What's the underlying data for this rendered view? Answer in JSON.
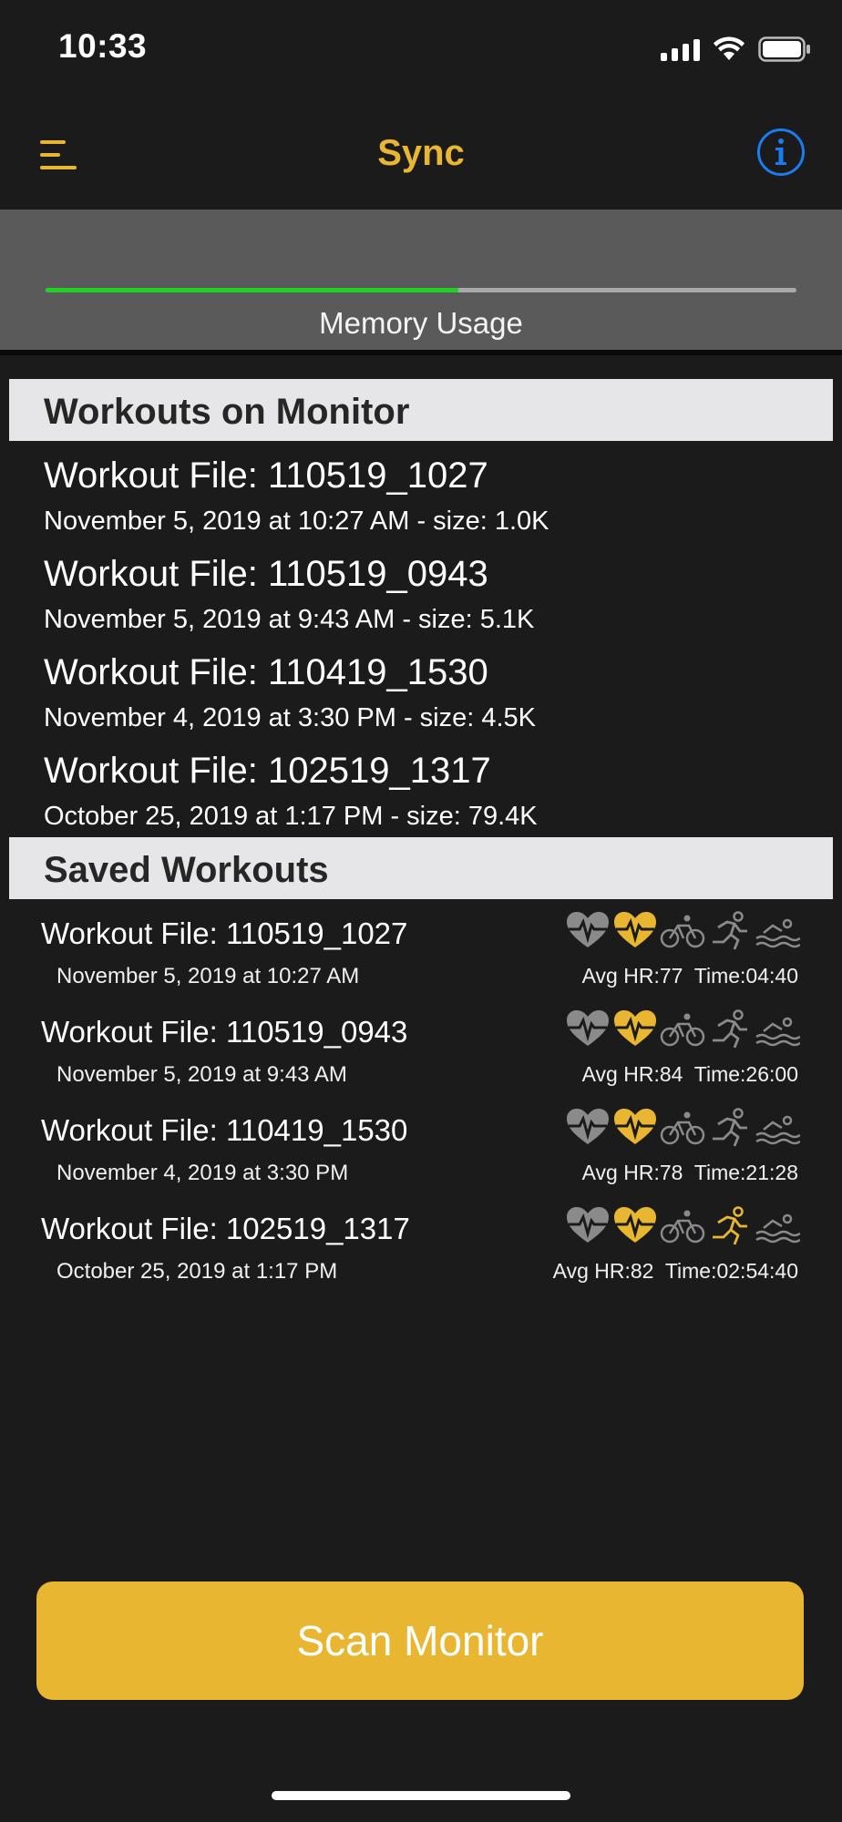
{
  "status_bar": {
    "time": "10:33",
    "icons": [
      "cellular-signal-icon",
      "wifi-icon",
      "battery-icon"
    ]
  },
  "nav": {
    "title": "Sync",
    "menu_icon": "hamburger-menu-icon",
    "info_icon": "info-circle-icon"
  },
  "memory": {
    "label": "Memory Usage",
    "usage_fraction": 0.55
  },
  "monitor_section": {
    "header": "Workouts on Monitor",
    "items": [
      {
        "title": "Workout File: 110519_1027",
        "subtitle": "November 5, 2019 at 10:27 AM - size: 1.0K"
      },
      {
        "title": "Workout File: 110519_0943",
        "subtitle": "November 5, 2019 at 9:43 AM - size: 5.1K"
      },
      {
        "title": "Workout File: 110419_1530",
        "subtitle": "November 4, 2019 at 3:30 PM - size: 4.5K"
      },
      {
        "title": "Workout File: 102519_1317",
        "subtitle": "October 25, 2019 at 1:17 PM - size: 79.4K"
      }
    ]
  },
  "saved_section": {
    "header": "Saved Workouts",
    "items": [
      {
        "title": "Workout File: 110519_1027",
        "date": "November 5, 2019 at 10:27 AM",
        "stats": "Avg HR:77  Time:04:40",
        "active_sport": "none"
      },
      {
        "title": "Workout File: 110519_0943",
        "date": "November 5, 2019 at 9:43 AM",
        "stats": "Avg HR:84  Time:26:00",
        "active_sport": "none"
      },
      {
        "title": "Workout File: 110419_1530",
        "date": "November 4, 2019 at 3:30 PM",
        "stats": "Avg HR:78  Time:21:28",
        "active_sport": "none"
      },
      {
        "title": "Workout File: 102519_1317",
        "date": "October 25, 2019 at 1:17 PM",
        "stats": "Avg HR:82  Time:02:54:40",
        "active_sport": "run"
      }
    ],
    "icons": [
      "heart-rate-icon",
      "heart-active-icon",
      "bike-icon",
      "run-icon",
      "swim-icon"
    ]
  },
  "scan_button": {
    "label": "Scan Monitor"
  },
  "colors": {
    "accent": "#e8b631",
    "background": "#1b1b1b",
    "memory_fill": "#22d026",
    "info_blue": "#1a7cf0",
    "icon_inactive": "#8a8a8a"
  }
}
